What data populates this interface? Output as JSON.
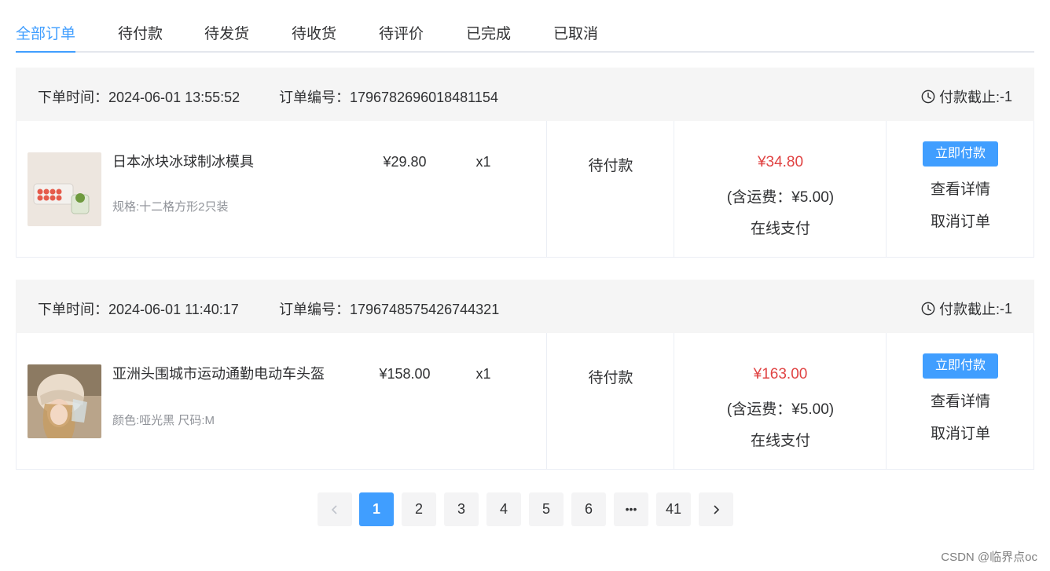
{
  "tabs": [
    {
      "label": "全部订单"
    },
    {
      "label": "待付款"
    },
    {
      "label": "待发货"
    },
    {
      "label": "待收货"
    },
    {
      "label": "待评价"
    },
    {
      "label": "已完成"
    },
    {
      "label": "已取消"
    }
  ],
  "active_tab": "全部订单",
  "orders": [
    {
      "time_label": "下单时间：",
      "time": "2024-06-01 13:55:52",
      "num_label": "订单编号：",
      "num": "1796782696018481154",
      "deadline_label": "付款截止: ",
      "deadline": "-1",
      "product_name": "日本冰块冰球制冰模具",
      "spec": "规格:十二格方形2只装",
      "price": "¥29.80",
      "qty": "x1",
      "status": "待付款",
      "total": "¥34.80",
      "shipping": "(含运费：¥5.00)",
      "pay_method": "在线支付",
      "pay_btn": "立即付款",
      "detail_link": "查看详情",
      "cancel_link": "取消订单"
    },
    {
      "time_label": "下单时间：",
      "time": "2024-06-01 11:40:17",
      "num_label": "订单编号：",
      "num": "1796748575426744321",
      "deadline_label": "付款截止: ",
      "deadline": "-1",
      "product_name": "亚洲头围城市运动通勤电动车头盔",
      "spec": "颜色:哑光黑 尺码:M",
      "price": "¥158.00",
      "qty": "x1",
      "status": "待付款",
      "total": "¥163.00",
      "shipping": "(含运费：¥5.00)",
      "pay_method": "在线支付",
      "pay_btn": "立即付款",
      "detail_link": "查看详情",
      "cancel_link": "取消订单"
    }
  ],
  "pagination": {
    "prev": "‹",
    "pages": [
      "1",
      "2",
      "3",
      "4",
      "5",
      "6"
    ],
    "ellipsis": "•••",
    "last": "41",
    "next": "›",
    "current": 1
  },
  "icons": {
    "clock": "clock-icon",
    "prev": "chevron-left-icon",
    "next": "chevron-right-icon"
  },
  "colors": {
    "accent": "#409eff",
    "price_red": "#e04343",
    "header_bg": "#f5f5f5"
  },
  "watermark": "CSDN @临界点oc"
}
